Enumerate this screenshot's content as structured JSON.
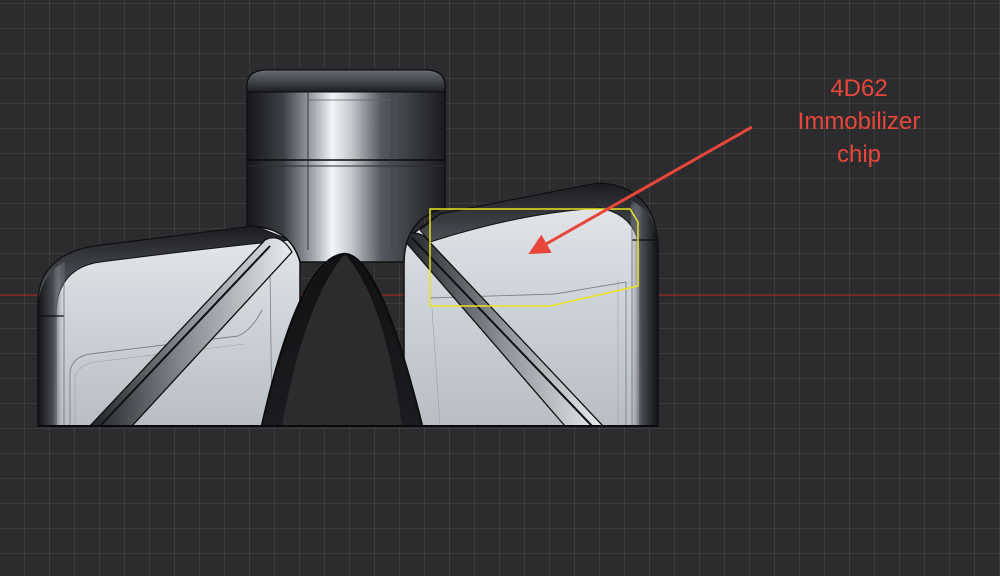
{
  "annotation": {
    "lines": [
      "4D62",
      "Immobilizer",
      "chip"
    ],
    "color": "#e8463a"
  },
  "highlight_box": {
    "color": "#e8e41f"
  },
  "axis_line": {
    "color": "#b02a2a"
  },
  "part": {
    "body_color": "#c6ccd3",
    "edge_color": "#111111",
    "icon": "key-head-3d-model"
  }
}
